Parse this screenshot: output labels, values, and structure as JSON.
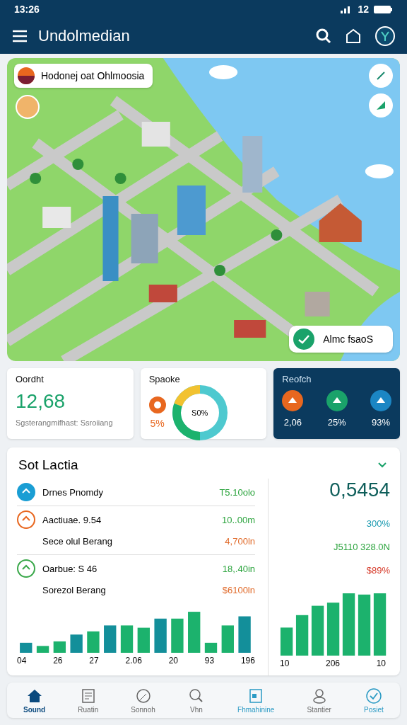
{
  "status_bar": {
    "time": "13:26",
    "battery": "12"
  },
  "app_bar": {
    "title": "Undolmedian"
  },
  "map": {
    "location": "Hodonej oat Ohlmoosia",
    "callout": "Almc fsaoS"
  },
  "cards": [
    {
      "kind": "stat",
      "title": "Oordht",
      "value": "12,68",
      "caption": "Sgsterangmifhast: Ssroiiang"
    },
    {
      "kind": "donut",
      "title": "Spaoke",
      "percent": "5%",
      "center": "S0%"
    },
    {
      "kind": "icons",
      "title": "Reofch",
      "items": [
        "2,06",
        "25%",
        "93%"
      ]
    }
  ],
  "section": {
    "title": "Sot Lactia",
    "rows": [
      {
        "label": "Drnes Pnomdy",
        "value": "T5.10olo",
        "color": "#2aa33c"
      },
      {
        "label": "Aactiuae. 9.54",
        "value": "10..00m",
        "color": "#2aa33c",
        "sub": {
          "label": "Sece olul Berang",
          "value": "4,700ln",
          "color": "#e06a2a"
        }
      },
      {
        "label": "Oarbue: S 46",
        "value": "18,.40in",
        "color": "#2aa33c",
        "sub": {
          "label": "Sorezol Berang",
          "value": "$6100ln",
          "color": "#e06a2a"
        }
      }
    ],
    "x_labels": [
      "04",
      "26",
      "27",
      "2.06",
      "20",
      "93",
      "196"
    ],
    "side": {
      "value": "0,5454",
      "lines": [
        {
          "text": "300%",
          "color": "#1a9ab0"
        },
        {
          "text": "J5110 328.0N",
          "color": "#2aa33c"
        },
        {
          "text": "$89%",
          "color": "#d63a2a"
        }
      ],
      "x_labels": [
        "10",
        "206",
        "10"
      ]
    }
  },
  "nav": [
    {
      "label": "Sound",
      "selected": true,
      "accent": false
    },
    {
      "label": "Ruatin",
      "selected": false,
      "accent": false
    },
    {
      "label": "Sonnoh",
      "selected": false,
      "accent": false
    },
    {
      "label": "Vhn",
      "selected": false,
      "accent": false
    },
    {
      "label": "Fhmahinine",
      "selected": false,
      "accent": true
    },
    {
      "label": "Stantier",
      "selected": false,
      "accent": false
    },
    {
      "label": "Posiet",
      "selected": false,
      "accent": true
    }
  ]
}
